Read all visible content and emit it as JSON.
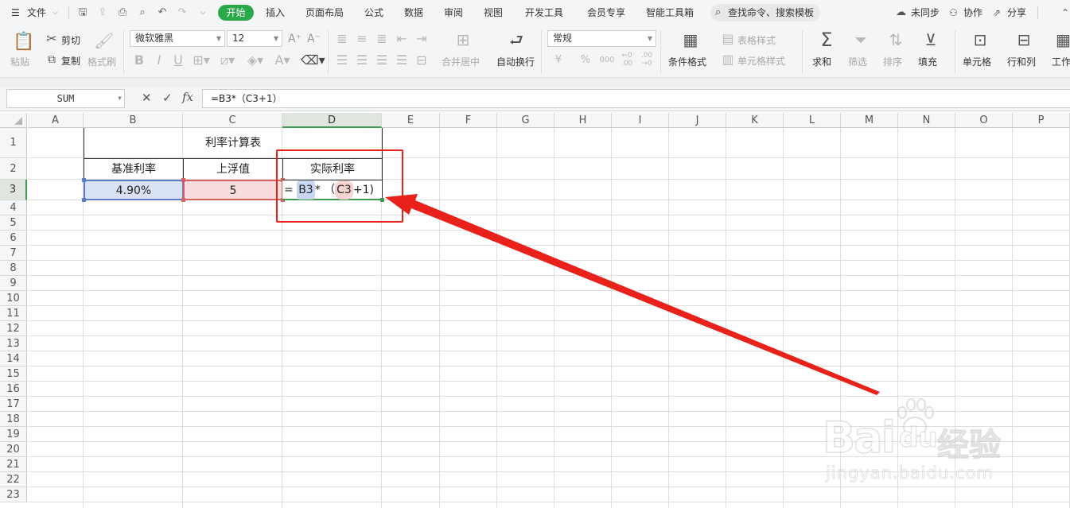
{
  "menubar": {
    "file_label": "文件",
    "tabs": [
      "开始",
      "插入",
      "页面布局",
      "公式",
      "数据",
      "审阅",
      "视图",
      "开发工具",
      "会员专享",
      "智能工具箱"
    ],
    "search_placeholder": "查找命令、搜索模板",
    "sync_label": "未同步",
    "collab_label": "协作",
    "share_label": "分享"
  },
  "ribbon": {
    "paste": "粘贴",
    "cut": "剪切",
    "copy": "复制",
    "format_painter": "格式刷",
    "font_name": "微软雅黑",
    "font_size": "12",
    "merge_center": "合并居中",
    "wrap_text": "自动换行",
    "number_format": "常规",
    "conditional_format": "条件格式",
    "table_style": "表格样式",
    "cell_style": "单元格样式",
    "sum": "求和",
    "filter": "筛选",
    "sort": "排序",
    "fill": "填充",
    "cell": "单元格",
    "row_col": "行和列",
    "worksheet": "工作",
    "currency_symbol": "¥",
    "percent_symbol": "%",
    "thousands_symbol": "000",
    "increase_decimal": "←0 .00",
    "decrease_decimal": ".00 →0"
  },
  "formula_bar": {
    "name_box": "SUM",
    "cancel": "✕",
    "confirm": "✓",
    "fx": "fx",
    "formula": "=B3*（C3+1）"
  },
  "columns": [
    "A",
    "B",
    "C",
    "D",
    "E",
    "F",
    "G",
    "H",
    "I",
    "J",
    "K",
    "L",
    "M",
    "N",
    "O",
    "P"
  ],
  "rows": [
    "1",
    "2",
    "3",
    "4",
    "5",
    "6",
    "7",
    "8",
    "9",
    "10",
    "11",
    "12",
    "13",
    "14",
    "15",
    "16",
    "17",
    "18",
    "19",
    "20",
    "21",
    "22",
    "23"
  ],
  "table": {
    "title": "利率计算表",
    "headers": [
      "基准利率",
      "上浮值",
      "实际利率"
    ],
    "b3": "4.90%",
    "c3": "5",
    "d3_eq": "=",
    "d3_ref1": "B3",
    "d3_op": "*  （",
    "d3_ref2": "C3",
    "d3_tail": "+1)"
  },
  "watermark": {
    "brand": "Bai",
    "brand2": "du",
    "brand_cn": "经验",
    "url": "jingyan.baidu.com"
  },
  "colors": {
    "accent_green": "#2aa84a",
    "annotation_red": "#e8211a",
    "ref1_blue": "#c9d6f0",
    "ref2_red": "#f5d3d3"
  }
}
